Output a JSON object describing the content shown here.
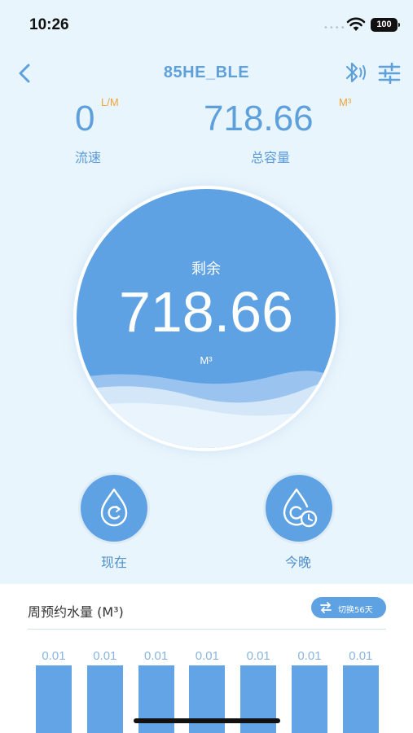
{
  "status_bar": {
    "time": "10:26",
    "battery": "100"
  },
  "header": {
    "title": "85HE_BLE"
  },
  "flow": {
    "value": "0",
    "unit": "L/M",
    "label": "流速"
  },
  "capacity": {
    "value": "718.66",
    "unit": "M³",
    "label": "总容量"
  },
  "remaining": {
    "label": "剩余",
    "value": "718.66",
    "unit": "M³"
  },
  "modes": [
    {
      "label": "现在",
      "icon": "water-drop-refresh-icon"
    },
    {
      "label": "今晚",
      "icon": "water-drop-clock-icon"
    }
  ],
  "weekly": {
    "title": "周预约水量 (M³)",
    "switch_label": "切换56天",
    "bars": [
      {
        "label": "0.01",
        "value": 0.01
      },
      {
        "label": "0.01",
        "value": 0.01
      },
      {
        "label": "0.01",
        "value": 0.01
      },
      {
        "label": "0.01",
        "value": 0.01
      },
      {
        "label": "0.01",
        "value": 0.01
      },
      {
        "label": "0.01",
        "value": 0.01
      },
      {
        "label": "0.01",
        "value": 0.01
      }
    ]
  },
  "colors": {
    "primary": "#5ea2e3",
    "accent": "#f0a33a",
    "background": "#e9f5fc"
  }
}
